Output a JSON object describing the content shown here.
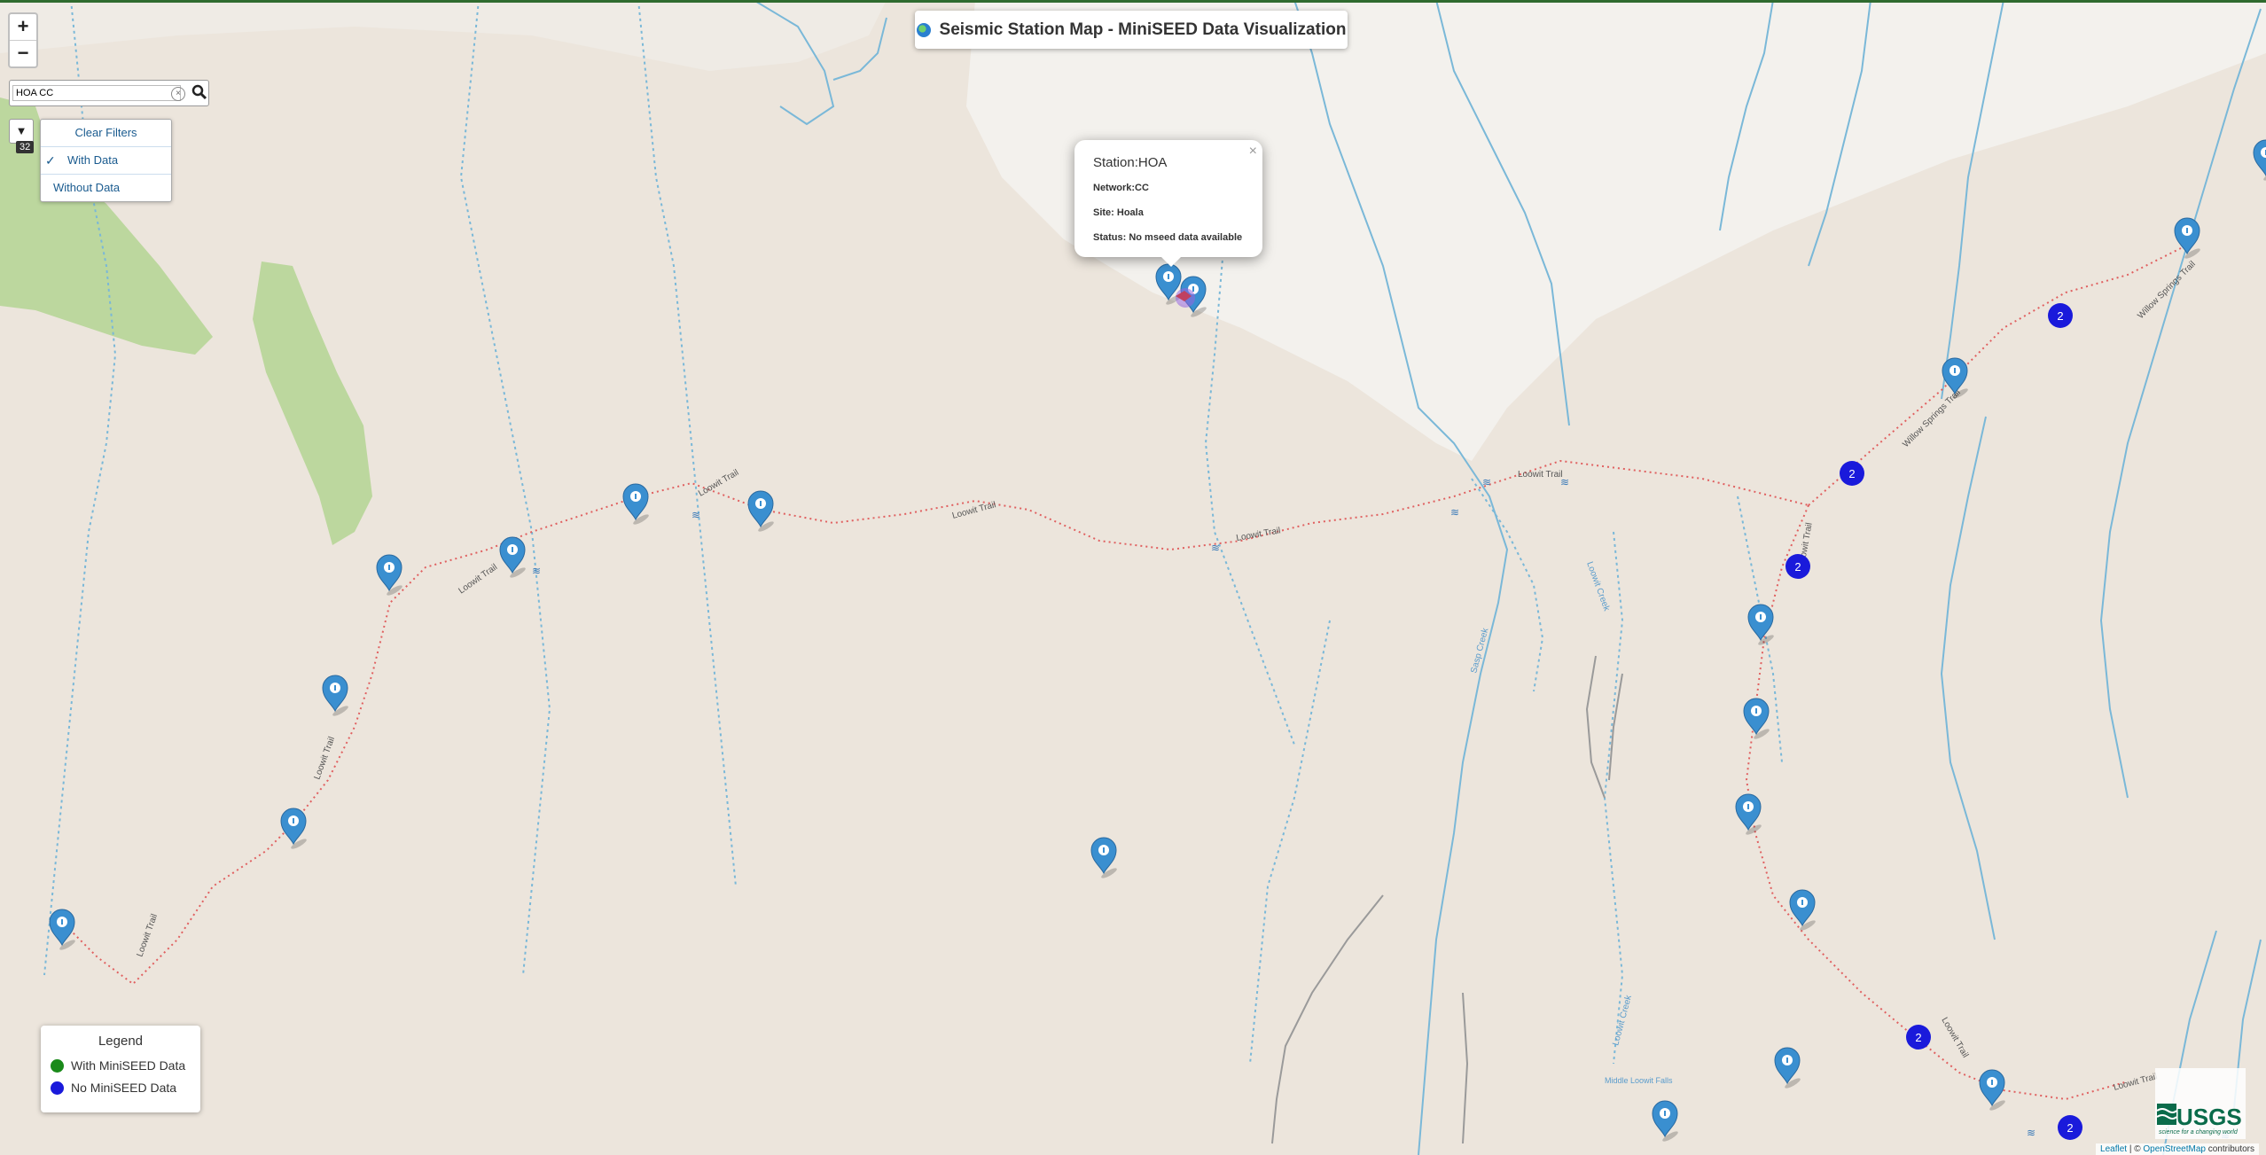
{
  "title": "Seismic Station Map - MiniSEED Data Visualization",
  "zoom": {
    "in_label": "+",
    "out_label": "−"
  },
  "search": {
    "value": "HOA CC"
  },
  "filter": {
    "count": "32",
    "items": [
      "Clear Filters",
      "With Data",
      "Without Data"
    ],
    "selected": "With Data"
  },
  "popup": {
    "station": "Station:HOA",
    "network": "Network:CC",
    "site": "Site: Hoala",
    "status": "Status: No mseed data available"
  },
  "legend": {
    "title": "Legend",
    "with_label": "With MiniSEED Data",
    "without_label": "No MiniSEED Data",
    "with_color": "#1a8a1a",
    "without_color": "#1a1adb"
  },
  "map_labels": {
    "trail": "Loowit Trail",
    "trail2": "Willow Springs Trail",
    "creek": "Loowit Creek",
    "creek2": "Sasp Creek",
    "falls": "Middle Loowit Falls"
  },
  "cluster_counts": [
    "2",
    "2",
    "2",
    "2",
    "2"
  ],
  "usgs_logo": "USGS",
  "usgs_tagline": "science for a changing world",
  "attribution": {
    "leaflet": "Leaflet",
    "sep": " | © ",
    "osm": "OpenStreetMap",
    "rest": " contributors"
  },
  "colors": {
    "marker": "#3a8fd0",
    "cluster": "#1a1adb",
    "trail": "#e06060",
    "stream": "#7ab8d8",
    "vegetation": "#b9d69a",
    "snow": "#f2f0ec"
  }
}
